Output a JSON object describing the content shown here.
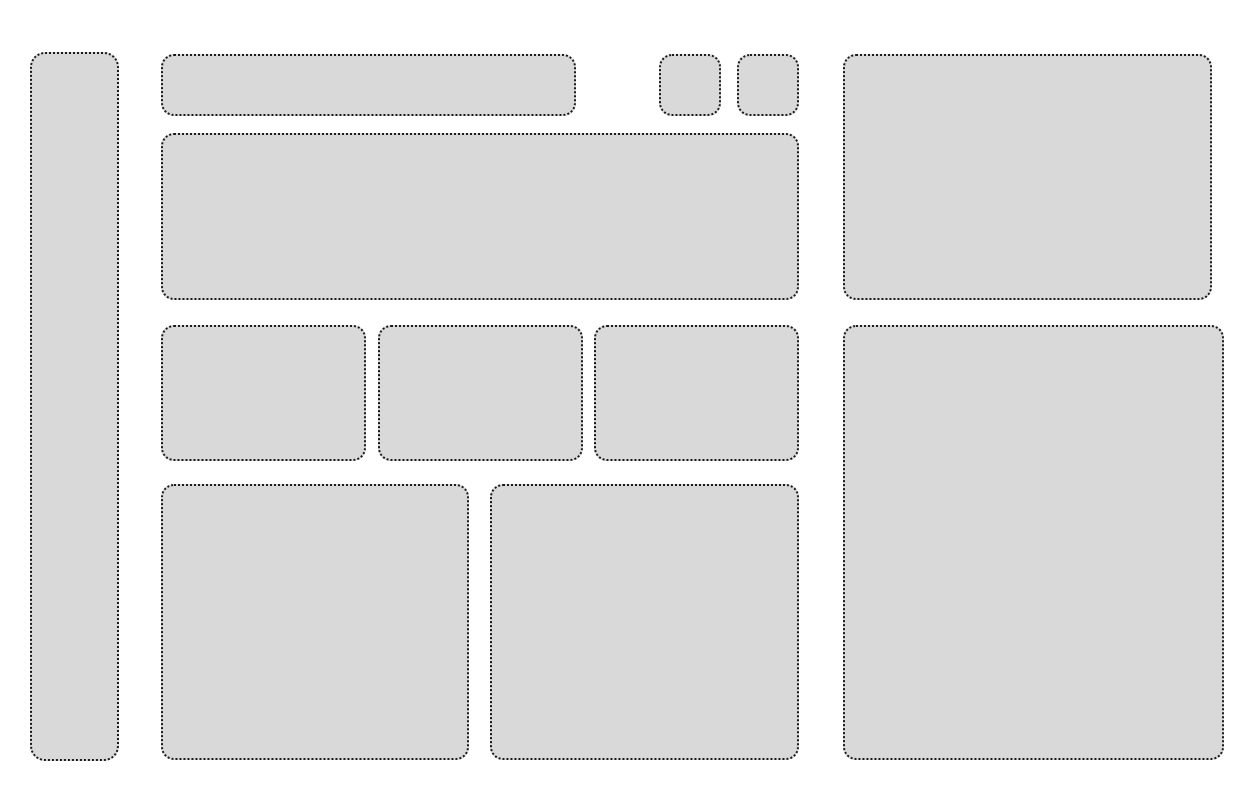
{
  "wireframe": {
    "fill_color": "#d9d9d9",
    "border_color": "#1a1a1a",
    "background_color": "#ffffff"
  }
}
